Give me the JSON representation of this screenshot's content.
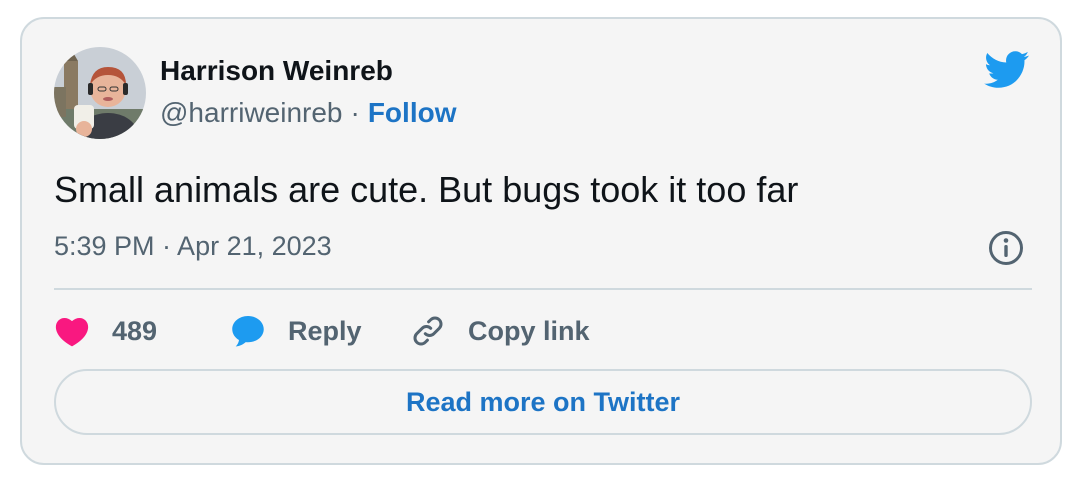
{
  "author": {
    "name": "Harrison Weinreb",
    "handle": "@harriweinreb",
    "separator": "·",
    "follow_label": "Follow"
  },
  "tweet": {
    "text": "Small animals are cute. But bugs took it too far",
    "timestamp": "5:39 PM · Apr 21, 2023"
  },
  "actions": {
    "like_count": "489",
    "reply_label": "Reply",
    "copy_link_label": "Copy link"
  },
  "read_more_label": "Read more on Twitter",
  "colors": {
    "card_background": "#f5f5f5",
    "border": "#cfd9de",
    "link_blue": "#1d74c5",
    "twitter_blue": "#1d9bf0",
    "like_pink": "#f91880",
    "text_primary": "#0f1419",
    "text_secondary": "#536471"
  },
  "icons": {
    "brand": "twitter-bird-icon",
    "info": "info-icon",
    "like": "heart-icon",
    "reply": "speech-bubble-icon",
    "copy_link": "link-icon"
  }
}
